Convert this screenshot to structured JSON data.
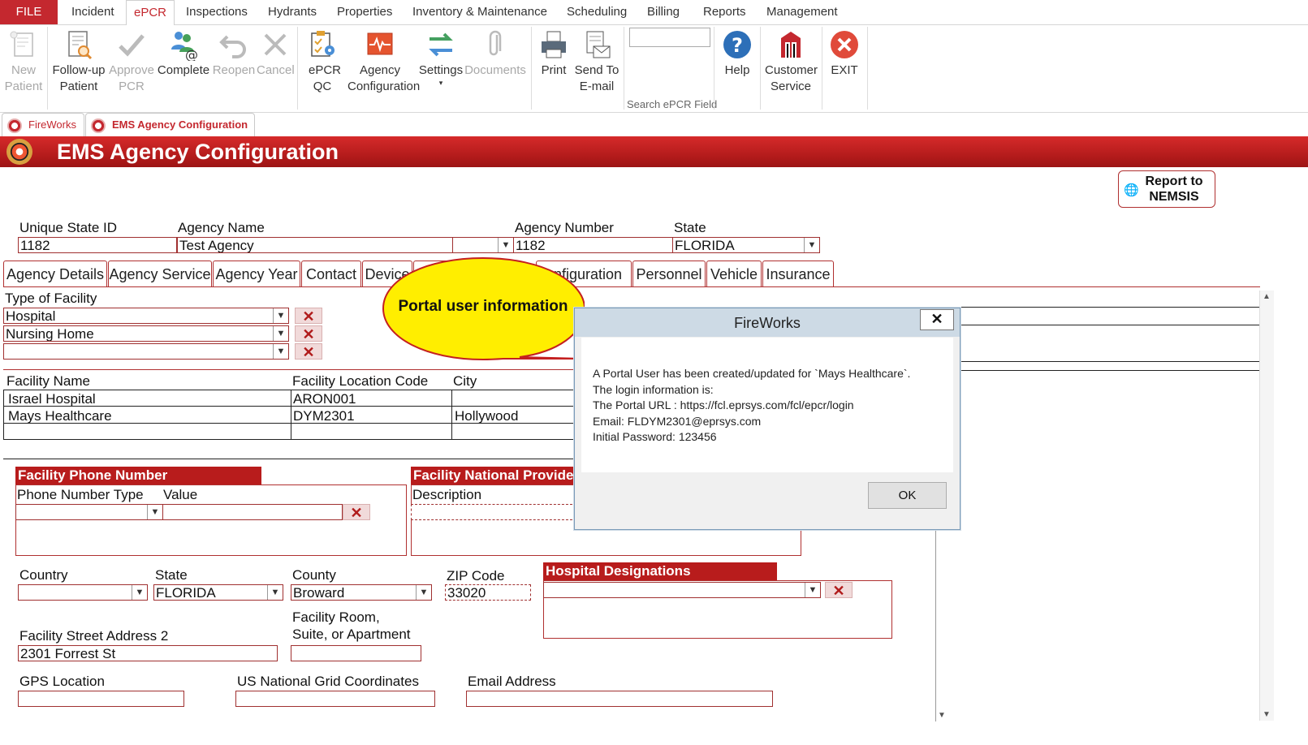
{
  "menubar": {
    "file": "FILE",
    "items": [
      "Incident",
      "ePCR",
      "Inspections",
      "Hydrants",
      "Properties",
      "Inventory & Maintenance",
      "Scheduling",
      "Billing",
      "Reports",
      "Management"
    ]
  },
  "ribbon": {
    "new_patient": "New Patient",
    "follow_up": "Follow-up Patient",
    "approve_pcr": "Approve PCR",
    "complete": "Complete",
    "reopen": "Reopen",
    "cancel": "Cancel",
    "epcr_qc": "ePCR QC",
    "agency_config": "Agency Configuration",
    "settings": "Settings",
    "documents": "Documents",
    "print": "Print",
    "send_email": "Send To E-mail",
    "search_label": "Search ePCR Field",
    "search_value": "",
    "help": "Help",
    "customer_service": "Customer Service",
    "exit": "EXIT"
  },
  "doc_tabs": [
    "FireWorks",
    "EMS Agency Configuration"
  ],
  "banner_title": "EMS Agency Configuration",
  "report_button": "Report to NEMSIS",
  "header_fields": {
    "unique_state_id_label": "Unique State ID",
    "unique_state_id": "1182",
    "agency_name_label": "Agency Name",
    "agency_name": "Test Agency",
    "agency_number_label": "Agency Number",
    "agency_number": "1182",
    "state_label": "State",
    "state": "FLORIDA"
  },
  "form_tabs": [
    "Agency Details",
    "Agency Service",
    "Agency Year",
    "Contact",
    "Device",
    "",
    "onfiguration",
    "Personnel",
    "Vehicle",
    "Insurance"
  ],
  "facility_types": {
    "label": "Type of Facility",
    "rows": [
      "Hospital",
      "Nursing Home",
      ""
    ]
  },
  "facility_table": {
    "headers": [
      "Facility Name",
      "Facility Location Code",
      "City"
    ],
    "rows": [
      {
        "name": "Israel Hospital",
        "code": "ARON001",
        "city": ""
      },
      {
        "name": "Mays Healthcare",
        "code": "DYM2301",
        "city": "Hollywood"
      },
      {
        "name": "",
        "code": "",
        "city": ""
      }
    ]
  },
  "phone_section": {
    "title": "Facility Phone Number",
    "col_type": "Phone Number Type",
    "col_value": "Value"
  },
  "npi_section": {
    "title": "Facility National Provide",
    "col_description": "Description"
  },
  "address": {
    "country_label": "Country",
    "country": "",
    "state_label": "State",
    "state": "FLORIDA",
    "county_label": "County",
    "county": "Broward",
    "zip_label": "ZIP Code",
    "zip": "33020",
    "street2_label": "Facility Street Address 2",
    "street2": "2301 Forrest St",
    "room_label_1": "Facility Room,",
    "room_label_2": "Suite, or Apartment",
    "room": "",
    "gps_label": "GPS Location",
    "usng_label": "US National Grid Coordinates",
    "email_label": "Email Address"
  },
  "hospital_designations": {
    "title": "Hospital Designations"
  },
  "callout": "Portal user information",
  "dialog": {
    "title": "FireWorks",
    "close": "✕",
    "lines": [
      "A Portal User has been created/updated for `Mays Healthcare`.",
      "The login information is:",
      "The Portal URL : https://fcl.eprsys.com/fcl/epcr/login",
      "Email: FLDYM2301@eprsys.com",
      "Initial Password: 123456"
    ],
    "ok": "OK"
  },
  "colors": {
    "brand_red": "#c4282f",
    "banner_red": "#b81c1c",
    "callout_yellow": "#ffee00"
  }
}
